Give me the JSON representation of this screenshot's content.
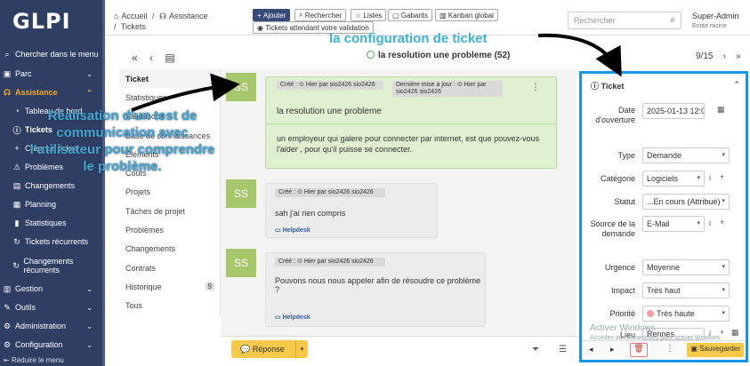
{
  "sidebar": {
    "logo": "GLPI",
    "items": [
      {
        "label": "Chercher dans le menu",
        "icon": "search-icon"
      },
      {
        "label": "Parc",
        "icon": "box-icon"
      },
      {
        "label": "Assistance",
        "icon": "headset-icon"
      },
      {
        "label": "Tableau de bord",
        "icon": "dashboard-icon"
      },
      {
        "label": "Tickets",
        "icon": "alert-icon"
      },
      {
        "label": "Créer un ticket",
        "icon": "plus-icon"
      },
      {
        "label": "Problèmes",
        "icon": "problem-icon"
      },
      {
        "label": "Changements",
        "icon": "change-icon"
      },
      {
        "label": "Planning",
        "icon": "calendar-icon"
      },
      {
        "label": "Statistiques",
        "icon": "chart-icon"
      },
      {
        "label": "Tickets récurrents",
        "icon": "recurrent-icon"
      },
      {
        "label": "Changements récurrents",
        "icon": "recurrent-icon"
      },
      {
        "label": "Gestion",
        "icon": "wallet-icon"
      },
      {
        "label": "Outils",
        "icon": "tools-icon"
      },
      {
        "label": "Administration",
        "icon": "admin-icon"
      },
      {
        "label": "Configuration",
        "icon": "gear-icon"
      }
    ],
    "collapse_label": "Réduire le menu"
  },
  "topbar": {
    "breadcrumb": [
      "Accueil",
      "Assistance",
      "Tickets"
    ],
    "buttons": [
      "Ajouter",
      "Rechercher",
      "Listes",
      "Gabarits",
      "Kanban global",
      "Tickets attendant votre validation"
    ],
    "search_placeholder": "Rechercher",
    "user_name": "Super-Admin",
    "user_entity": "Entité racine"
  },
  "ticket": {
    "title": "la resolution une probleme (52)",
    "pager": "9/15",
    "overlay_title": "la configuration de ticket"
  },
  "tabs": [
    {
      "label": "Ticket"
    },
    {
      "label": "Statistiques"
    },
    {
      "label": "Validations"
    },
    {
      "label": "Base de connaissances"
    },
    {
      "label": "Éléments"
    },
    {
      "label": "Coûts"
    },
    {
      "label": "Projets"
    },
    {
      "label": "Tâches de projet"
    },
    {
      "label": "Problèmes"
    },
    {
      "label": "Changements"
    },
    {
      "label": "Contrats"
    },
    {
      "label": "Historique",
      "badge": "9"
    },
    {
      "label": "Tous"
    }
  ],
  "timeline": [
    {
      "avatar": "SS",
      "meta_created": "Créé : ⊙ Hier par  sio2426 sio2426",
      "meta_updated": "Dernière mise à jour : ⊙ Hier par  sio2426 sio2426",
      "title": "la resolution une probleme",
      "body": "un employeur qui galere pour connecter par internet, est que pouvez-vous l'aider , pour qu'il puisse se connecter."
    },
    {
      "avatar": "SS",
      "meta_created": "Créé : ⊙ Hier par  sio2426 sio2426",
      "body": "sah j'ai rien compris",
      "source": "Helpdesk"
    },
    {
      "avatar": "SS",
      "meta_created": "Créé : ⊙ Hier par  sio2426 sio2426",
      "body": "Pouvons nous nous appeler afin de résoudre ce problème ?",
      "source": "Helpdesk"
    }
  ],
  "bottom": {
    "reply_label": "Réponse"
  },
  "panel": {
    "title": "Ticket",
    "fields": [
      {
        "label": "Date d'ouverture",
        "value": "2025-01-13 12:0"
      },
      {
        "label": "Type",
        "value": "Demande"
      },
      {
        "label": "Catégorie",
        "value": "Logiciels"
      },
      {
        "label": "Statut",
        "value": "...En cours (Attribué)"
      },
      {
        "label": "Source de la demande",
        "value": "E-Mail"
      },
      {
        "label": "Urgence",
        "value": "Moyenne"
      },
      {
        "label": "Impact",
        "value": "Très haut"
      },
      {
        "label": "Priorité",
        "value": "Très haute"
      },
      {
        "label": "Lieu",
        "value": "Rennes"
      }
    ],
    "save_label": "Sauvegarder"
  },
  "watermark": {
    "line1": "Activer Windows",
    "line2": "Accédez aux paramètres pour activer Windows."
  },
  "annotation": "Réalisation d'un test de communication avec l'utilisateur pour comprendre le problème."
}
